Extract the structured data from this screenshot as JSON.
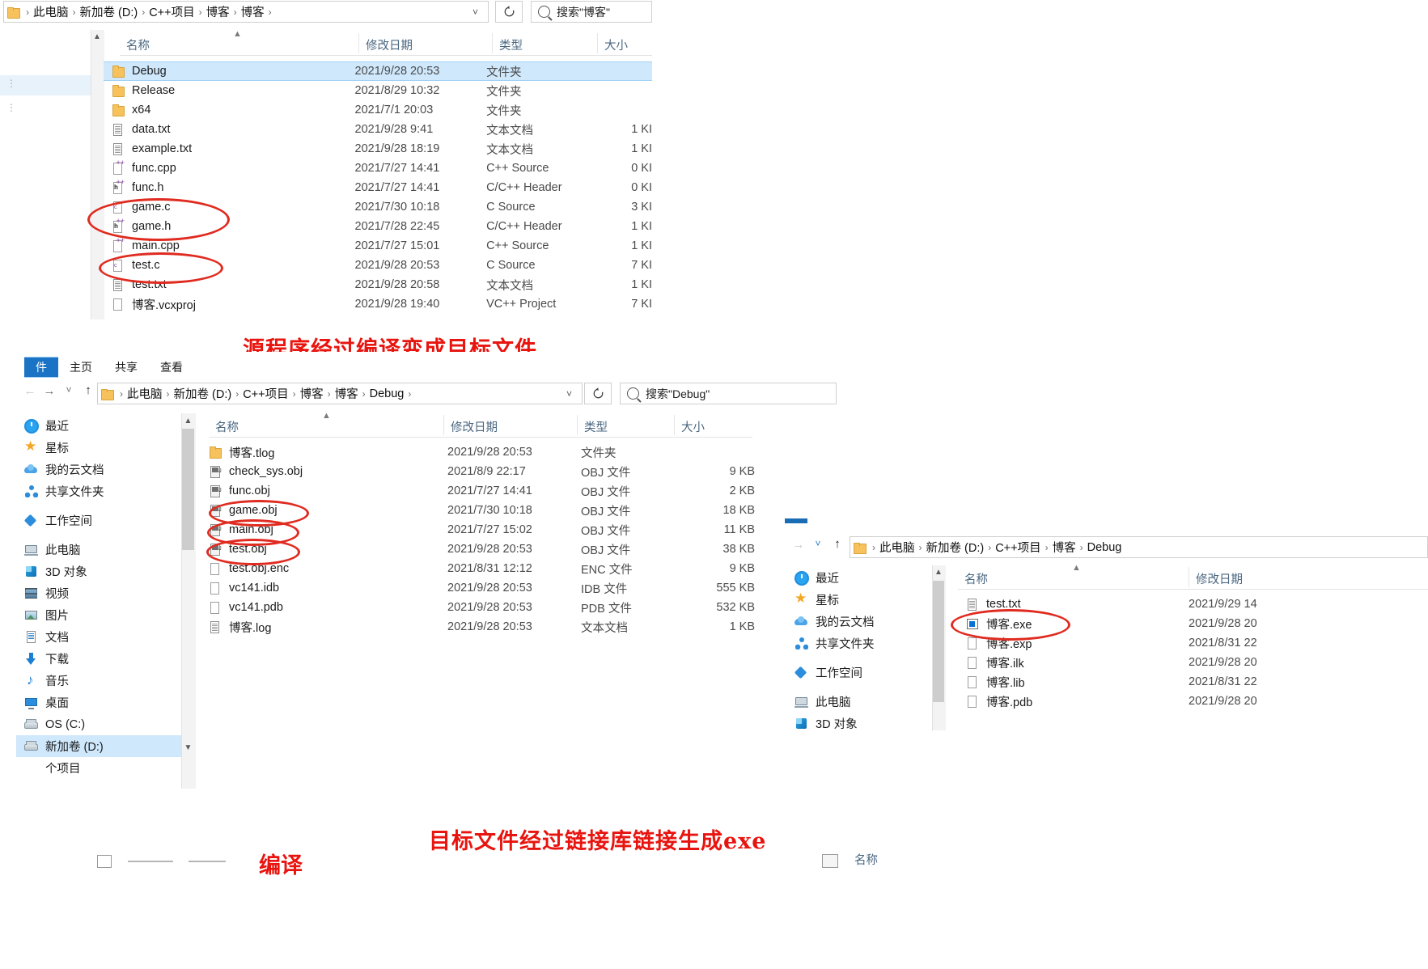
{
  "window1": {
    "name": "explorer-window-project-root",
    "address": {
      "crumbs": [
        "此电脑",
        "新加卷 (D:)",
        "C++项目",
        "博客",
        "博客"
      ],
      "dropdown_icon": "chevron-down-icon",
      "refresh_icon": "refresh-icon"
    },
    "search": {
      "placeholder": "搜索\"博客\"",
      "icon": "search-icon"
    },
    "columns": [
      "名称",
      "修改日期",
      "类型",
      "大小"
    ],
    "rows": [
      {
        "name": "Debug",
        "date": "2021/9/28 20:53",
        "type": "文件夹",
        "size": "",
        "icon": "folder",
        "selected": true
      },
      {
        "name": "Release",
        "date": "2021/8/29 10:32",
        "type": "文件夹",
        "size": "",
        "icon": "folder",
        "selected": false
      },
      {
        "name": "x64",
        "date": "2021/7/1 20:03",
        "type": "文件夹",
        "size": "",
        "icon": "folder",
        "selected": false
      },
      {
        "name": "data.txt",
        "date": "2021/9/28 9:41",
        "type": "文本文档",
        "size": "1 KI",
        "icon": "doc",
        "selected": false
      },
      {
        "name": "example.txt",
        "date": "2021/9/28 18:19",
        "type": "文本文档",
        "size": "1 KI",
        "icon": "doc",
        "selected": false
      },
      {
        "name": "func.cpp",
        "date": "2021/7/27 14:41",
        "type": "C++ Source",
        "size": "0 KI",
        "icon": "cpp",
        "selected": false
      },
      {
        "name": "func.h",
        "date": "2021/7/27 14:41",
        "type": "C/C++ Header",
        "size": "0 KI",
        "icon": "hpp",
        "selected": false
      },
      {
        "name": "game.c",
        "date": "2021/7/30 10:18",
        "type": "C Source",
        "size": "3 KI",
        "icon": "csrc",
        "selected": false
      },
      {
        "name": "game.h",
        "date": "2021/7/28 22:45",
        "type": "C/C++ Header",
        "size": "1 KI",
        "icon": "hpp",
        "selected": false
      },
      {
        "name": "main.cpp",
        "date": "2021/7/27 15:01",
        "type": "C++ Source",
        "size": "1 KI",
        "icon": "cpp",
        "selected": false
      },
      {
        "name": "test.c",
        "date": "2021/9/28 20:53",
        "type": "C Source",
        "size": "7 KI",
        "icon": "csrc",
        "selected": false
      },
      {
        "name": "test.txt",
        "date": "2021/9/28 20:58",
        "type": "文本文档",
        "size": "1 KI",
        "icon": "doc",
        "selected": false
      },
      {
        "name": "博客.vcxproj",
        "date": "2021/9/28 19:40",
        "type": "VC++ Project",
        "size": "7 KI",
        "icon": "blank",
        "selected": false
      }
    ]
  },
  "caption1": "源程序经过编译变成目标文件",
  "caption2": "目标文件经过链接库链接生成exe",
  "caption3": "编译",
  "window2": {
    "name": "explorer-window-debug",
    "ribbon_tabs": [
      "件",
      "主页",
      "共享",
      "查看"
    ],
    "address": {
      "crumbs": [
        "此电脑",
        "新加卷 (D:)",
        "C++项目",
        "博客",
        "博客",
        "Debug"
      ],
      "back_icon": "arrow-left-icon",
      "forward_icon": "arrow-right-icon",
      "history_icon": "chevron-down-icon",
      "up_icon": "arrow-up-icon",
      "dropdown_icon": "chevron-down-icon",
      "refresh_icon": "refresh-icon"
    },
    "search": {
      "placeholder": "搜索\"Debug\"",
      "icon": "search-icon"
    },
    "sidebar": [
      {
        "label": "最近",
        "icon": "clock",
        "active": false
      },
      {
        "label": "星标",
        "icon": "star",
        "active": false
      },
      {
        "label": "我的云文档",
        "icon": "cloud",
        "active": false
      },
      {
        "label": "共享文件夹",
        "icon": "share",
        "active": false
      },
      {
        "label": "工作空间",
        "icon": "ws",
        "active": false
      },
      {
        "label": "此电脑",
        "icon": "pc",
        "active": false
      },
      {
        "label": "3D 对象",
        "icon": "d3",
        "active": false
      },
      {
        "label": "视频",
        "icon": "video",
        "active": false
      },
      {
        "label": "图片",
        "icon": "pic",
        "active": false
      },
      {
        "label": "文档",
        "icon": "docs",
        "active": false
      },
      {
        "label": "下载",
        "icon": "dl",
        "active": false
      },
      {
        "label": "音乐",
        "icon": "music",
        "active": false
      },
      {
        "label": "桌面",
        "icon": "desk",
        "active": false
      },
      {
        "label": "OS (C:)",
        "icon": "disk",
        "active": false
      },
      {
        "label": "新加卷 (D:)",
        "icon": "disk",
        "active": true
      },
      {
        "label": "个项目",
        "icon": "none",
        "active": false
      }
    ],
    "columns": [
      "名称",
      "修改日期",
      "类型",
      "大小"
    ],
    "rows": [
      {
        "name": "博客.tlog",
        "date": "2021/9/28 20:53",
        "type": "文件夹",
        "size": "",
        "icon": "folder"
      },
      {
        "name": "check_sys.obj",
        "date": "2021/8/9 22:17",
        "type": "OBJ 文件",
        "size": "9 KB",
        "icon": "obj"
      },
      {
        "name": "func.obj",
        "date": "2021/7/27 14:41",
        "type": "OBJ 文件",
        "size": "2 KB",
        "icon": "obj"
      },
      {
        "name": "game.obj",
        "date": "2021/7/30 10:18",
        "type": "OBJ 文件",
        "size": "18 KB",
        "icon": "obj"
      },
      {
        "name": "main.obj",
        "date": "2021/7/27 15:02",
        "type": "OBJ 文件",
        "size": "11 KB",
        "icon": "obj"
      },
      {
        "name": "test.obj",
        "date": "2021/9/28 20:53",
        "type": "OBJ 文件",
        "size": "38 KB",
        "icon": "obj"
      },
      {
        "name": "test.obj.enc",
        "date": "2021/8/31 12:12",
        "type": "ENC 文件",
        "size": "9 KB",
        "icon": "blank"
      },
      {
        "name": "vc141.idb",
        "date": "2021/9/28 20:53",
        "type": "IDB 文件",
        "size": "555 KB",
        "icon": "blank"
      },
      {
        "name": "vc141.pdb",
        "date": "2021/9/28 20:53",
        "type": "PDB 文件",
        "size": "532 KB",
        "icon": "blank"
      },
      {
        "name": "博客.log",
        "date": "2021/9/28 20:53",
        "type": "文本文档",
        "size": "1 KB",
        "icon": "doc"
      }
    ]
  },
  "window3": {
    "name": "explorer-window-debug-output",
    "address": {
      "crumbs": [
        "此电脑",
        "新加卷 (D:)",
        "C++项目",
        "博客",
        "Debug"
      ],
      "forward_icon": "arrow-right-icon",
      "history_icon": "chevron-down-icon",
      "up_icon": "arrow-up-icon"
    },
    "sidebar": [
      {
        "label": "最近",
        "icon": "clock"
      },
      {
        "label": "星标",
        "icon": "star"
      },
      {
        "label": "我的云文档",
        "icon": "cloud"
      },
      {
        "label": "共享文件夹",
        "icon": "share"
      },
      {
        "label": "工作空间",
        "icon": "ws"
      },
      {
        "label": "此电脑",
        "icon": "pc"
      },
      {
        "label": "3D 对象",
        "icon": "d3"
      }
    ],
    "columns": [
      "名称",
      "修改日期"
    ],
    "rows": [
      {
        "name": "test.txt",
        "date": "2021/9/29 14",
        "icon": "doc"
      },
      {
        "name": "博客.exe",
        "date": "2021/9/28 20",
        "icon": "exe"
      },
      {
        "name": "博客.exp",
        "date": "2021/8/31 22",
        "icon": "blank"
      },
      {
        "name": "博客.ilk",
        "date": "2021/9/28 20",
        "icon": "blank"
      },
      {
        "name": "博客.lib",
        "date": "2021/8/31 22",
        "icon": "blank"
      },
      {
        "name": "博客.pdb",
        "date": "2021/9/28 20",
        "icon": "blank"
      }
    ]
  },
  "window4": {
    "name": "explorer-window-bottom-partial",
    "column": "名称"
  },
  "colors": {
    "accent": "#1a6cb5",
    "selection": "#cfe8fc",
    "annotation": "#e02b20",
    "caption": "#e8140f",
    "header_text": "#4a6781"
  }
}
